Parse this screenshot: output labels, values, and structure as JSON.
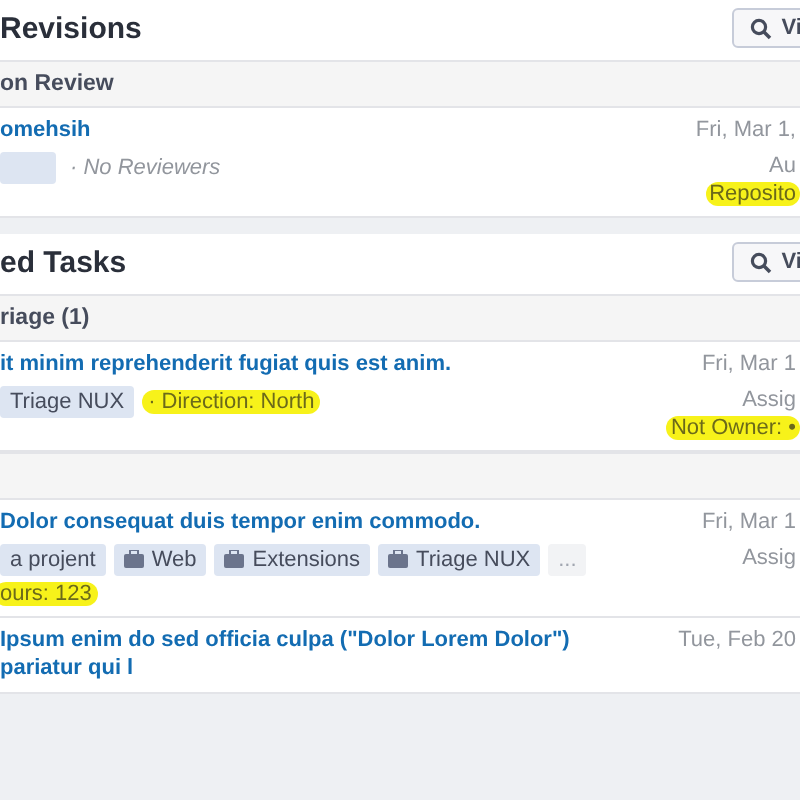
{
  "sections": [
    {
      "title": "Revisions",
      "button": "Vi",
      "groups": [
        {
          "header": "on Review",
          "items": [
            {
              "title": "omehsih",
              "tags": [
                {
                  "kind": "blank"
                }
              ],
              "meta": [
                {
                  "text": "· No Reviewers",
                  "italic": true,
                  "highlighted": false
                }
              ],
              "right": [
                {
                  "text": "Fri, Mar 1,",
                  "highlighted": false
                },
                {
                  "text": "Au",
                  "highlighted": false
                },
                {
                  "text": "Reposito",
                  "highlighted": true
                }
              ]
            }
          ]
        }
      ]
    },
    {
      "title": "ed Tasks",
      "button": "Vi",
      "groups": [
        {
          "header": "riage (1)",
          "items": [
            {
              "title": "it minim reprehenderit fugiat quis est anim.",
              "tags": [
                {
                  "kind": "plain",
                  "label": "Triage NUX"
                }
              ],
              "meta": [
                {
                  "text": "· Direction: North",
                  "italic": false,
                  "highlighted": true
                }
              ],
              "right": [
                {
                  "text": "Fri, Mar 1",
                  "highlighted": false
                },
                {
                  "text": "Assig",
                  "highlighted": false
                },
                {
                  "text": "Not Owner: •",
                  "highlighted": true
                }
              ]
            }
          ]
        },
        {
          "items": [
            {
              "title": "Dolor consequat duis tempor enim commodo.",
              "tags": [
                {
                  "kind": "plain",
                  "label": "a projent"
                },
                {
                  "kind": "project",
                  "label": "Web"
                },
                {
                  "kind": "project",
                  "label": "Extensions"
                },
                {
                  "kind": "project",
                  "label": "Triage NUX"
                },
                {
                  "kind": "more",
                  "label": "..."
                }
              ],
              "lines": [
                {
                  "text": "ours: 123",
                  "highlighted": true
                }
              ],
              "right": [
                {
                  "text": "Fri, Mar 1",
                  "highlighted": false
                },
                {
                  "text": "Assig",
                  "highlighted": false
                }
              ]
            },
            {
              "title": "Ipsum enim do sed officia culpa (\"Dolor Lorem Dolor\") pariatur qui l",
              "right": [
                {
                  "text": "Tue, Feb 20",
                  "highlighted": false
                }
              ]
            }
          ]
        }
      ]
    }
  ]
}
